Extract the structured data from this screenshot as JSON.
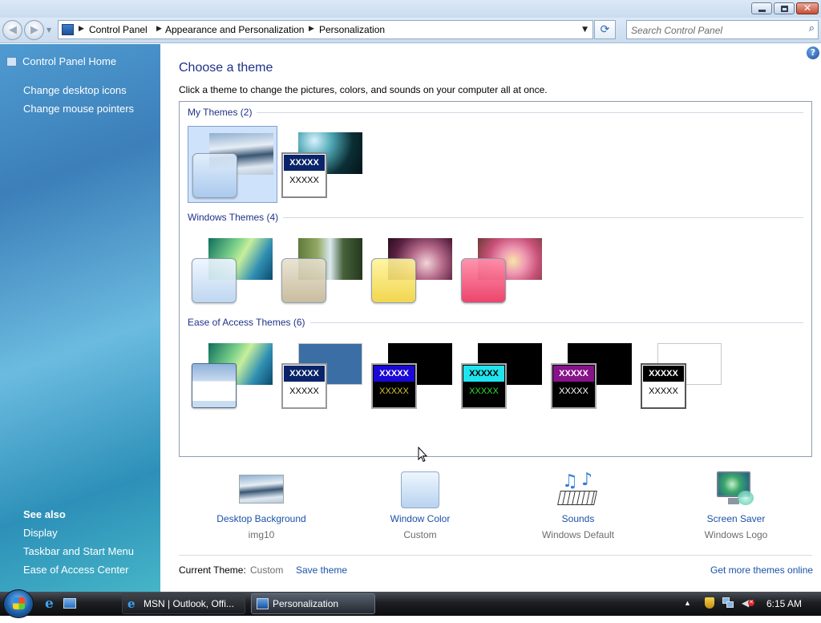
{
  "breadcrumb": [
    "Control Panel",
    "Appearance and Personalization",
    "Personalization"
  ],
  "search": {
    "placeholder": "Search Control Panel"
  },
  "sidebar": {
    "home": "Control Panel Home",
    "tasks": [
      "Change desktop icons",
      "Change mouse pointers"
    ],
    "see_also_title": "See also",
    "see_also": [
      "Display",
      "Taskbar and Start Menu",
      "Ease of Access Center"
    ]
  },
  "main": {
    "title": "Choose a theme",
    "description": "Click a theme to change the pictures, colors, and sounds on your computer all at once.",
    "groups": {
      "my": "My Themes (2)",
      "windows": "Windows Themes (4)",
      "ease": "Ease of Access Themes (6)"
    },
    "contrast_sample": {
      "title_text": "XXXXX",
      "body_text": "XXXXX"
    }
  },
  "settings": [
    {
      "label": "Desktop Background",
      "value": "img10",
      "icon": "mountain-photo-icon"
    },
    {
      "label": "Window Color",
      "value": "Custom",
      "icon": "window-color-icon"
    },
    {
      "label": "Sounds",
      "value": "Windows Default",
      "icon": "music-notes-keyboard-icon"
    },
    {
      "label": "Screen Saver",
      "value": "Windows Logo",
      "icon": "monitor-logo-icon"
    }
  ],
  "footer": {
    "current_theme_label": "Current Theme:",
    "current_theme_value": "Custom",
    "save_theme": "Save theme",
    "get_more": "Get more themes online"
  },
  "taskbar": {
    "tasks": [
      "MSN | Outlook, Offi...",
      "Personalization"
    ],
    "clock": "6:15 AM"
  },
  "colors": {
    "link": "#1a52a8",
    "heading": "#1e3287",
    "selected": "#cfe2fb"
  }
}
